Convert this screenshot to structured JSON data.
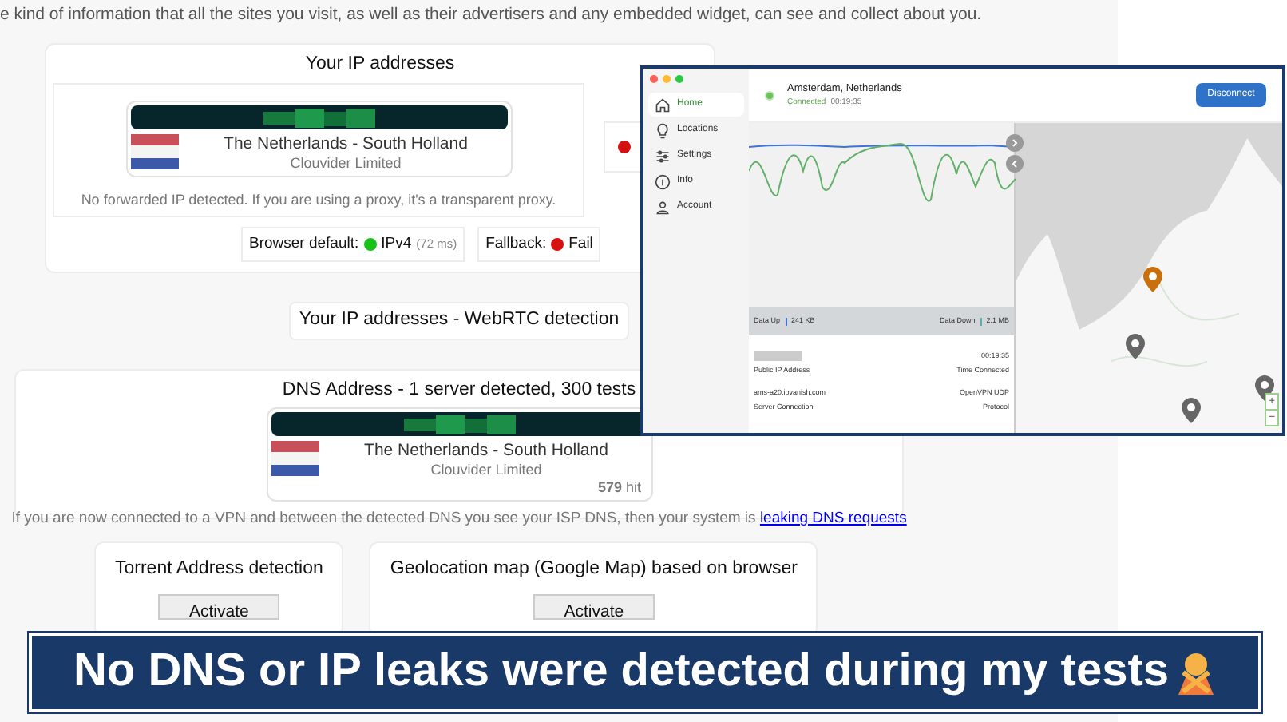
{
  "intro_text": "e kind of information that all the sites you visit, as well as their advertisers and any embedded widget, can see and collect about you.",
  "ip_card": {
    "title": "Your IP addresses",
    "entry": {
      "location": "The Netherlands - South Holland",
      "isp": "Clouvider Limited"
    },
    "note": "No forwarded IP detected. If you are using a proxy, it's a transparent proxy.",
    "side_ok": false,
    "protocols": [
      {
        "label": "Browser default:",
        "value": "IPv4",
        "detail": "(72 ms)",
        "ok": true
      },
      {
        "label": "Fallback:",
        "value": "Fail",
        "ok": false
      }
    ]
  },
  "webrtc_title": "Your IP addresses - WebRTC detection",
  "dns_card": {
    "title": "DNS Address - 1 server detected, 300 tests",
    "entry": {
      "location": "The Netherlands - South Holland",
      "isp": "Clouvider Limited",
      "hits": "579",
      "hits_unit": "hit"
    },
    "note": "If you are now connected to a VPN and between the detected DNS you see your ISP DNS, then your system is",
    "link": "leaking DNS requests"
  },
  "tools": [
    {
      "title": "Torrent Address detection",
      "button": "Activate"
    },
    {
      "title": "Geolocation map (Google Map) based on browser",
      "button": "Activate"
    }
  ],
  "vpn_app": {
    "sidebar": [
      {
        "label": "Home",
        "selected": true
      },
      {
        "label": "Locations",
        "selected": false
      },
      {
        "label": "Settings",
        "selected": false
      },
      {
        "label": "Info",
        "selected": false
      },
      {
        "label": "Account",
        "selected": false
      }
    ],
    "location": "Amsterdam, Netherlands",
    "connected": true,
    "status": "Connected",
    "elapsed": "00:19:35",
    "button": "Disconnect",
    "data_up_label": "Data Up",
    "data_up": "241 KB",
    "data_down_label": "Data Down",
    "data_down": "2.1 MB",
    "public_ip_label": "Public IP Address",
    "details": [
      {
        "label": "Time Connected",
        "value": "00:19:35"
      },
      {
        "label": "Server Connection",
        "value": "ams-a20.ipvanish.com"
      },
      {
        "label": "Protocol",
        "value": "OpenVPN UDP"
      }
    ],
    "map_pins": [
      {
        "selected": true
      },
      {
        "selected": false
      },
      {
        "selected": false
      },
      {
        "selected": false
      }
    ],
    "zoom_in": "+",
    "zoom_out": "−"
  },
  "banner": {
    "text": "No DNS or IP leaks were detected during my tests"
  }
}
